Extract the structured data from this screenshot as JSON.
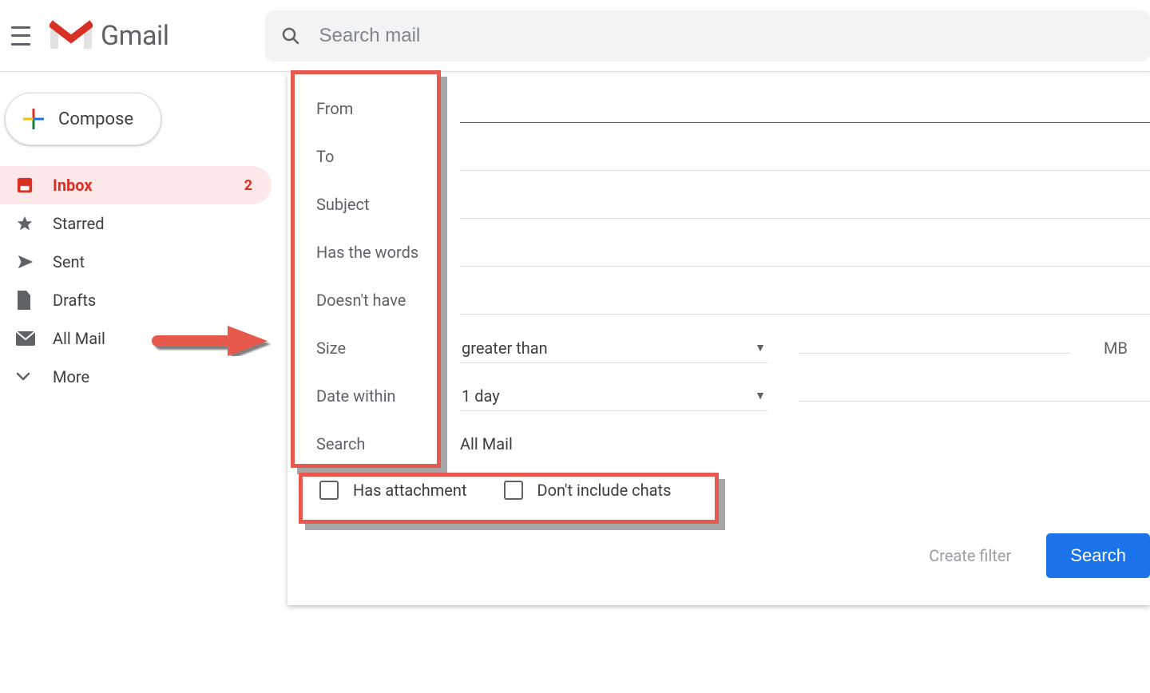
{
  "header": {
    "product_name": "Gmail",
    "search_placeholder": "Search mail"
  },
  "sidebar": {
    "compose_label": "Compose",
    "items": [
      {
        "id": "inbox",
        "label": "Inbox",
        "badge": "2",
        "active": true
      },
      {
        "id": "starred",
        "label": "Starred"
      },
      {
        "id": "sent",
        "label": "Sent"
      },
      {
        "id": "drafts",
        "label": "Drafts"
      },
      {
        "id": "allmail",
        "label": "All Mail"
      },
      {
        "id": "more",
        "label": "More"
      }
    ]
  },
  "filter": {
    "labels": {
      "from": "From",
      "to": "To",
      "subject": "Subject",
      "has_words": "Has the words",
      "doesnt_have": "Doesn't have",
      "size": "Size",
      "date_within": "Date within",
      "search": "Search"
    },
    "values": {
      "from": "",
      "to": "",
      "subject": "",
      "has_words": "",
      "doesnt_have": "",
      "size_operator": "greater than",
      "size_value": "",
      "size_unit": "MB",
      "date_range": "1 day",
      "date_value": "",
      "search_scope": "All Mail"
    },
    "checkboxes": {
      "has_attachment": "Has attachment",
      "dont_include_chats": "Don't include chats"
    },
    "actions": {
      "create_filter": "Create filter",
      "search": "Search"
    }
  }
}
